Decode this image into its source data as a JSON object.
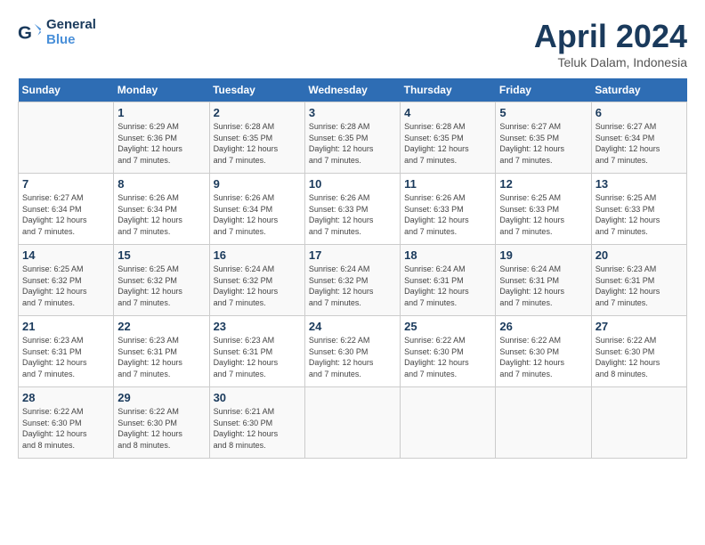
{
  "header": {
    "logo_line1": "General",
    "logo_line2": "Blue",
    "month": "April 2024",
    "location": "Teluk Dalam, Indonesia"
  },
  "weekdays": [
    "Sunday",
    "Monday",
    "Tuesday",
    "Wednesday",
    "Thursday",
    "Friday",
    "Saturday"
  ],
  "weeks": [
    [
      {
        "day": "",
        "info": ""
      },
      {
        "day": "1",
        "info": "Sunrise: 6:29 AM\nSunset: 6:36 PM\nDaylight: 12 hours\nand 7 minutes."
      },
      {
        "day": "2",
        "info": "Sunrise: 6:28 AM\nSunset: 6:35 PM\nDaylight: 12 hours\nand 7 minutes."
      },
      {
        "day": "3",
        "info": "Sunrise: 6:28 AM\nSunset: 6:35 PM\nDaylight: 12 hours\nand 7 minutes."
      },
      {
        "day": "4",
        "info": "Sunrise: 6:28 AM\nSunset: 6:35 PM\nDaylight: 12 hours\nand 7 minutes."
      },
      {
        "day": "5",
        "info": "Sunrise: 6:27 AM\nSunset: 6:35 PM\nDaylight: 12 hours\nand 7 minutes."
      },
      {
        "day": "6",
        "info": "Sunrise: 6:27 AM\nSunset: 6:34 PM\nDaylight: 12 hours\nand 7 minutes."
      }
    ],
    [
      {
        "day": "7",
        "info": "Sunrise: 6:27 AM\nSunset: 6:34 PM\nDaylight: 12 hours\nand 7 minutes."
      },
      {
        "day": "8",
        "info": "Sunrise: 6:26 AM\nSunset: 6:34 PM\nDaylight: 12 hours\nand 7 minutes."
      },
      {
        "day": "9",
        "info": "Sunrise: 6:26 AM\nSunset: 6:34 PM\nDaylight: 12 hours\nand 7 minutes."
      },
      {
        "day": "10",
        "info": "Sunrise: 6:26 AM\nSunset: 6:33 PM\nDaylight: 12 hours\nand 7 minutes."
      },
      {
        "day": "11",
        "info": "Sunrise: 6:26 AM\nSunset: 6:33 PM\nDaylight: 12 hours\nand 7 minutes."
      },
      {
        "day": "12",
        "info": "Sunrise: 6:25 AM\nSunset: 6:33 PM\nDaylight: 12 hours\nand 7 minutes."
      },
      {
        "day": "13",
        "info": "Sunrise: 6:25 AM\nSunset: 6:33 PM\nDaylight: 12 hours\nand 7 minutes."
      }
    ],
    [
      {
        "day": "14",
        "info": "Sunrise: 6:25 AM\nSunset: 6:32 PM\nDaylight: 12 hours\nand 7 minutes."
      },
      {
        "day": "15",
        "info": "Sunrise: 6:25 AM\nSunset: 6:32 PM\nDaylight: 12 hours\nand 7 minutes."
      },
      {
        "day": "16",
        "info": "Sunrise: 6:24 AM\nSunset: 6:32 PM\nDaylight: 12 hours\nand 7 minutes."
      },
      {
        "day": "17",
        "info": "Sunrise: 6:24 AM\nSunset: 6:32 PM\nDaylight: 12 hours\nand 7 minutes."
      },
      {
        "day": "18",
        "info": "Sunrise: 6:24 AM\nSunset: 6:31 PM\nDaylight: 12 hours\nand 7 minutes."
      },
      {
        "day": "19",
        "info": "Sunrise: 6:24 AM\nSunset: 6:31 PM\nDaylight: 12 hours\nand 7 minutes."
      },
      {
        "day": "20",
        "info": "Sunrise: 6:23 AM\nSunset: 6:31 PM\nDaylight: 12 hours\nand 7 minutes."
      }
    ],
    [
      {
        "day": "21",
        "info": "Sunrise: 6:23 AM\nSunset: 6:31 PM\nDaylight: 12 hours\nand 7 minutes."
      },
      {
        "day": "22",
        "info": "Sunrise: 6:23 AM\nSunset: 6:31 PM\nDaylight: 12 hours\nand 7 minutes."
      },
      {
        "day": "23",
        "info": "Sunrise: 6:23 AM\nSunset: 6:31 PM\nDaylight: 12 hours\nand 7 minutes."
      },
      {
        "day": "24",
        "info": "Sunrise: 6:22 AM\nSunset: 6:30 PM\nDaylight: 12 hours\nand 7 minutes."
      },
      {
        "day": "25",
        "info": "Sunrise: 6:22 AM\nSunset: 6:30 PM\nDaylight: 12 hours\nand 7 minutes."
      },
      {
        "day": "26",
        "info": "Sunrise: 6:22 AM\nSunset: 6:30 PM\nDaylight: 12 hours\nand 7 minutes."
      },
      {
        "day": "27",
        "info": "Sunrise: 6:22 AM\nSunset: 6:30 PM\nDaylight: 12 hours\nand 8 minutes."
      }
    ],
    [
      {
        "day": "28",
        "info": "Sunrise: 6:22 AM\nSunset: 6:30 PM\nDaylight: 12 hours\nand 8 minutes."
      },
      {
        "day": "29",
        "info": "Sunrise: 6:22 AM\nSunset: 6:30 PM\nDaylight: 12 hours\nand 8 minutes."
      },
      {
        "day": "30",
        "info": "Sunrise: 6:21 AM\nSunset: 6:30 PM\nDaylight: 12 hours\nand 8 minutes."
      },
      {
        "day": "",
        "info": ""
      },
      {
        "day": "",
        "info": ""
      },
      {
        "day": "",
        "info": ""
      },
      {
        "day": "",
        "info": ""
      }
    ]
  ]
}
